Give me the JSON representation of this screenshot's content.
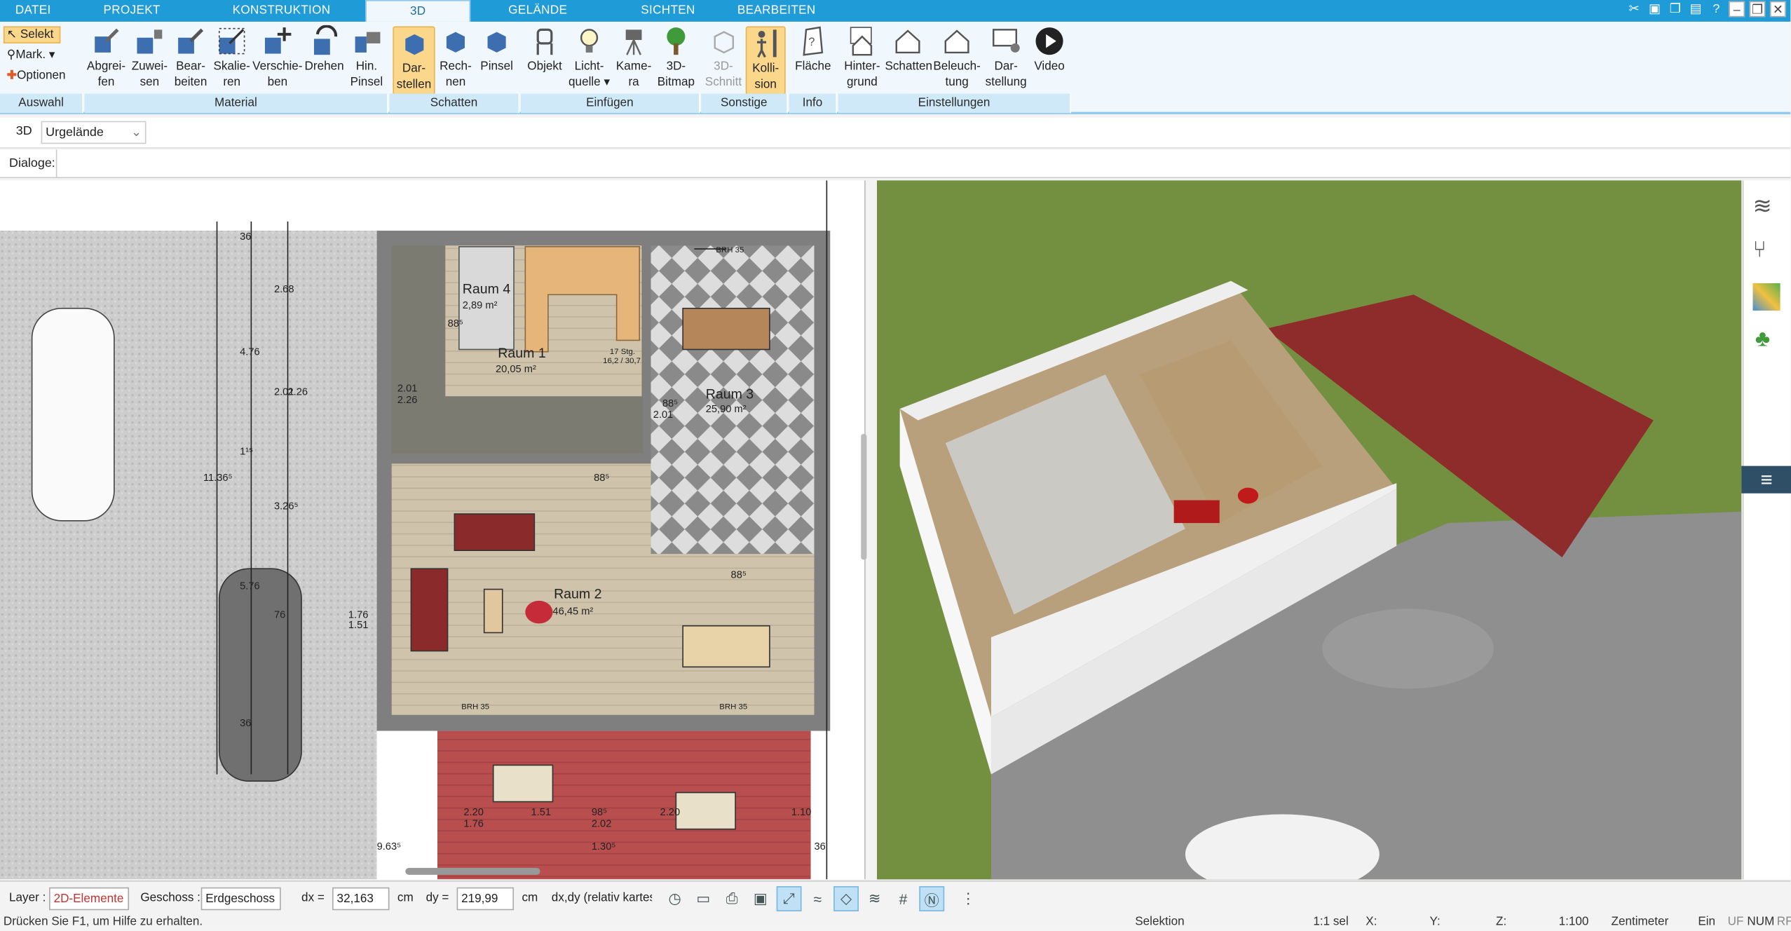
{
  "tabs": [
    "DATEI",
    "PROJEKT",
    "KONSTRUKTION",
    "3D",
    "GELÄNDE",
    "SICHTEN",
    "BEARBEITEN"
  ],
  "ribbon": {
    "auswahl": {
      "selekt": "Selekt",
      "mark": "Mark.",
      "optionen": "Optionen",
      "group": "Auswahl"
    },
    "material": {
      "group": "Material",
      "buttons": [
        [
          "Abgrei-",
          "fen"
        ],
        [
          "Zuwei-",
          "sen"
        ],
        [
          "Bear-",
          "beiten"
        ],
        [
          "Skalie-",
          "ren"
        ],
        [
          "Verschie-",
          "ben"
        ],
        [
          "Drehen",
          ""
        ],
        [
          "Hin.",
          "Pinsel"
        ]
      ]
    },
    "schatten": {
      "group": "Schatten",
      "buttons": [
        [
          "Dar-",
          "stellen"
        ],
        [
          "Rech-",
          "nen"
        ],
        [
          "Pinsel",
          ""
        ]
      ]
    },
    "einfuegen": {
      "group": "Einfügen",
      "buttons": [
        [
          "Objekt",
          ""
        ],
        [
          "Licht-",
          "quelle"
        ],
        [
          "Kame-",
          "ra"
        ],
        [
          "3D-",
          "Bitmap"
        ]
      ]
    },
    "sonstige": {
      "group": "Sonstige",
      "buttons": [
        [
          "3D-",
          "Schnitt"
        ],
        [
          "Kolli-",
          "sion"
        ]
      ]
    },
    "info": {
      "group": "Info",
      "buttons": [
        [
          "Fläche",
          ""
        ]
      ]
    },
    "einstellungen": {
      "group": "Einstellungen",
      "buttons": [
        [
          "Hinter-",
          "grund"
        ],
        [
          "Schatten",
          ""
        ],
        [
          "Beleuch-",
          "tung"
        ],
        [
          "Dar-",
          "stellung"
        ],
        [
          "Video",
          ""
        ]
      ]
    }
  },
  "bar3d": {
    "label": "3D",
    "value": "Urgelände"
  },
  "dialoge": "Dialoge:",
  "plan": {
    "rooms": [
      {
        "name": "Raum 4",
        "area": "2,89 m²"
      },
      {
        "name": "Raum 1",
        "area": "20,05 m²"
      },
      {
        "name": "Raum 3",
        "area": "25,90 m²"
      },
      {
        "name": "Raum 2",
        "area": "46,45 m²"
      }
    ],
    "stairs": "17 Stg.",
    "stairs2": "16,2 / 30,7",
    "dims": [
      "36",
      "2.68",
      "4.76",
      "2.01",
      "2.26",
      "11.36⁵",
      "1¹⁵",
      "3.26⁵",
      "5.76",
      "76",
      "36",
      "1.76",
      "1.51",
      "88⁵",
      "2.01",
      "2.01",
      "2.26",
      "88⁵",
      "2.01",
      "88⁵",
      "2.01",
      "BRH 35",
      "BRH 35",
      "BRH 35",
      "BRH 35",
      "BRH 35",
      "2.02",
      "2.20",
      "1.76",
      "1.51",
      "98⁵",
      "2.02",
      "2.20",
      "1.10",
      "1.30⁵",
      "9.63⁵",
      "36",
      "36",
      "1.76",
      "1.51",
      "1.76",
      "1.51"
    ]
  },
  "status": {
    "layer_label": "Layer :",
    "layer_value": "2D-Elemente",
    "geschoss_label": "Geschoss :",
    "geschoss_value": "Erdgeschoss",
    "dx_label": "dx =",
    "dx_value": "32,163",
    "dx_unit": "cm",
    "dy_label": "dy =",
    "dy_value": "219,99",
    "dy_unit": "cm",
    "mode_value": "dx,dy (relativ kartesisch)"
  },
  "help": {
    "text": "Drücken Sie F1, um Hilfe zu erhalten.",
    "selektion": "Selektion",
    "scale_sel": "1:1 sel",
    "x": "X:",
    "y": "Y:",
    "z": "Z:",
    "scale": "1:100",
    "unit": "Zentimeter",
    "ein": "Ein",
    "uf": "UF",
    "num": "NUM",
    "rf": "RF"
  }
}
